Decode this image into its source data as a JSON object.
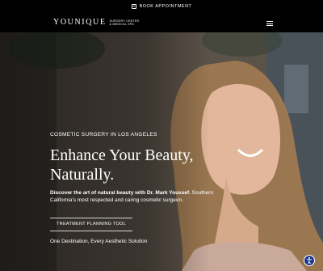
{
  "topbar": {
    "book_label": "BOOK APPOINTMENT",
    "calendar_icon": "calendar-icon"
  },
  "header": {
    "logo": {
      "wordmark": "YOUNIQUE",
      "sub_line1": "SURGERY CENTER",
      "sub_line2": "& MEDICAL SPA"
    },
    "menu_icon": "hamburger-menu-icon"
  },
  "hero": {
    "kicker": "COSMETIC SURGERY IN LOS ANGELES",
    "headline_line1": "Enhance Your Beauty,",
    "headline_line2": "Naturally.",
    "desc_bold": "Discover the art of natural beauty with Dr. Mark Youssef.",
    "desc_rest": " Southern California's most respected and caring cosmetic surgeon.",
    "cta_label": "TREATMENT PLANNING TOOL",
    "tagline": "One Destination, Every Aesthetic Solution"
  },
  "accessibility": {
    "icon": "accessibility-icon"
  },
  "colors": {
    "background": "#000000",
    "text": "#ffffff",
    "accessibility_button": "#1f3a8a"
  }
}
